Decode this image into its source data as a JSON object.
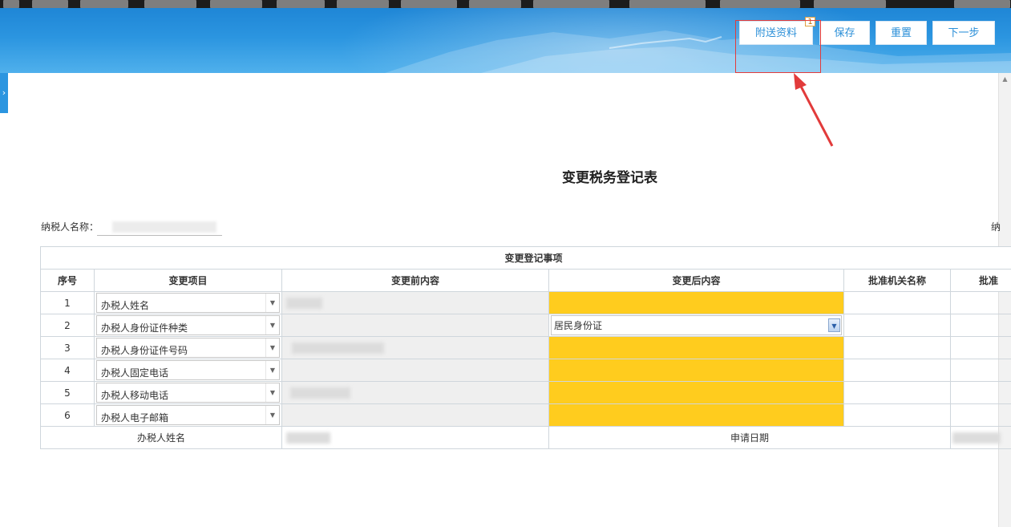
{
  "toolbar": {
    "attach_label": "附送资料",
    "attach_badge": "1",
    "save_label": "保存",
    "reset_label": "重置",
    "next_label": "下一步"
  },
  "form": {
    "title": "变更税务登记表",
    "taxpayer_name_label": "纳税人名称："
  },
  "table": {
    "group_header": "变更登记事项",
    "columns": [
      "序号",
      "变更项目",
      "变更前内容",
      "变更后内容",
      "批准机关名称",
      "批准"
    ],
    "rows": [
      {
        "no": "1",
        "item": "办税人姓名",
        "after": ""
      },
      {
        "no": "2",
        "item": "办税人身份证件种类",
        "after": "居民身份证"
      },
      {
        "no": "3",
        "item": "办税人身份证件号码",
        "after": ""
      },
      {
        "no": "4",
        "item": "办税人固定电话",
        "after": ""
      },
      {
        "no": "5",
        "item": "办税人移动电话",
        "after": ""
      },
      {
        "no": "6",
        "item": "办税人电子邮箱",
        "after": ""
      }
    ],
    "footer_left_label": "办税人姓名",
    "footer_mid_label": "申请日期"
  },
  "colors": {
    "banner": "#2b95e0",
    "highlight_field": "#ffcc1e",
    "annotation_red": "#e23b3b"
  },
  "icons": {
    "dropdown": "chevron-down-icon",
    "sidebar_toggle": "chevron-right-icon"
  }
}
